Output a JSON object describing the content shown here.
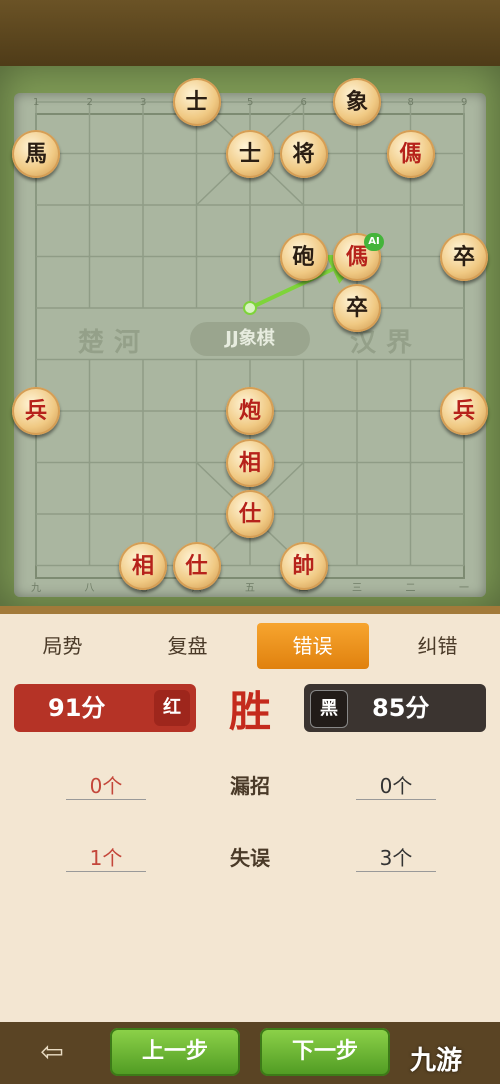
{
  "board": {
    "top_file_numbers": [
      "1",
      "2",
      "3",
      "4",
      "5",
      "6",
      "7",
      "8",
      "9"
    ],
    "bottom_file_numbers": [
      "九",
      "八",
      "七",
      "六",
      "五",
      "四",
      "三",
      "二",
      "一"
    ],
    "river_left": "楚河",
    "river_right": "汉界",
    "logo_text": "JJ象棋",
    "ai_badge": "AI",
    "last_move": {
      "from": [
        4,
        4
      ],
      "to": [
        6,
        3
      ]
    },
    "pieces": [
      {
        "name": "piece-shi-black-top",
        "char": "士",
        "side": "black",
        "col": 3,
        "row": 0
      },
      {
        "name": "piece-xiang-black",
        "char": "象",
        "side": "black",
        "col": 6,
        "row": 0
      },
      {
        "name": "piece-ma-black",
        "char": "馬",
        "side": "black",
        "col": 0,
        "row": 1
      },
      {
        "name": "piece-shi-black",
        "char": "士",
        "side": "black",
        "col": 4,
        "row": 1
      },
      {
        "name": "piece-jiang-black",
        "char": "将",
        "side": "black",
        "col": 5,
        "row": 1
      },
      {
        "name": "piece-ma-red-top",
        "char": "傌",
        "side": "red",
        "col": 7,
        "row": 1
      },
      {
        "name": "piece-pao-black",
        "char": "砲",
        "side": "black",
        "col": 5,
        "row": 3
      },
      {
        "name": "piece-ma-red-ai",
        "char": "傌",
        "side": "red",
        "col": 6,
        "row": 3
      },
      {
        "name": "piece-zu-black-right",
        "char": "卒",
        "side": "black",
        "col": 8,
        "row": 3
      },
      {
        "name": "piece-zu-black",
        "char": "卒",
        "side": "black",
        "col": 6,
        "row": 4
      },
      {
        "name": "piece-bing-red-left",
        "char": "兵",
        "side": "red",
        "col": 0,
        "row": 6
      },
      {
        "name": "piece-pao-red",
        "char": "炮",
        "side": "red",
        "col": 4,
        "row": 6
      },
      {
        "name": "piece-bing-red-right",
        "char": "兵",
        "side": "red",
        "col": 8,
        "row": 6
      },
      {
        "name": "piece-xiang-red-center",
        "char": "相",
        "side": "red",
        "col": 4,
        "row": 7
      },
      {
        "name": "piece-shi-red-center",
        "char": "仕",
        "side": "red",
        "col": 4,
        "row": 8
      },
      {
        "name": "piece-xiang-red",
        "char": "相",
        "side": "red",
        "col": 2,
        "row": 9
      },
      {
        "name": "piece-shi-red",
        "char": "仕",
        "side": "red",
        "col": 3,
        "row": 9
      },
      {
        "name": "piece-shuai-red",
        "char": "帥",
        "side": "red",
        "col": 5,
        "row": 9
      }
    ]
  },
  "tabs": [
    {
      "label": "局势",
      "active": false
    },
    {
      "label": "复盘",
      "active": false
    },
    {
      "label": "错误",
      "active": true
    },
    {
      "label": "纠错",
      "active": false
    }
  ],
  "score": {
    "red_value": "91分",
    "red_badge": "红",
    "result": "胜",
    "black_badge": "黑",
    "black_value": "85分"
  },
  "stats": [
    {
      "label": "漏招",
      "red": "0个",
      "black": "0个"
    },
    {
      "label": "失误",
      "red": "1个",
      "black": "3个"
    }
  ],
  "nav": {
    "back_icon": "exit-icon",
    "prev_label": "上一步",
    "next_label": "下一步"
  },
  "watermark": "九游",
  "colors": {
    "red_piece": "#b6221b",
    "black_piece": "#2a1e13",
    "active_tab": "#f0961c",
    "red_score_bg": "#b53326",
    "black_score_bg": "#3b3430",
    "nav_button": "#6fbb35"
  }
}
